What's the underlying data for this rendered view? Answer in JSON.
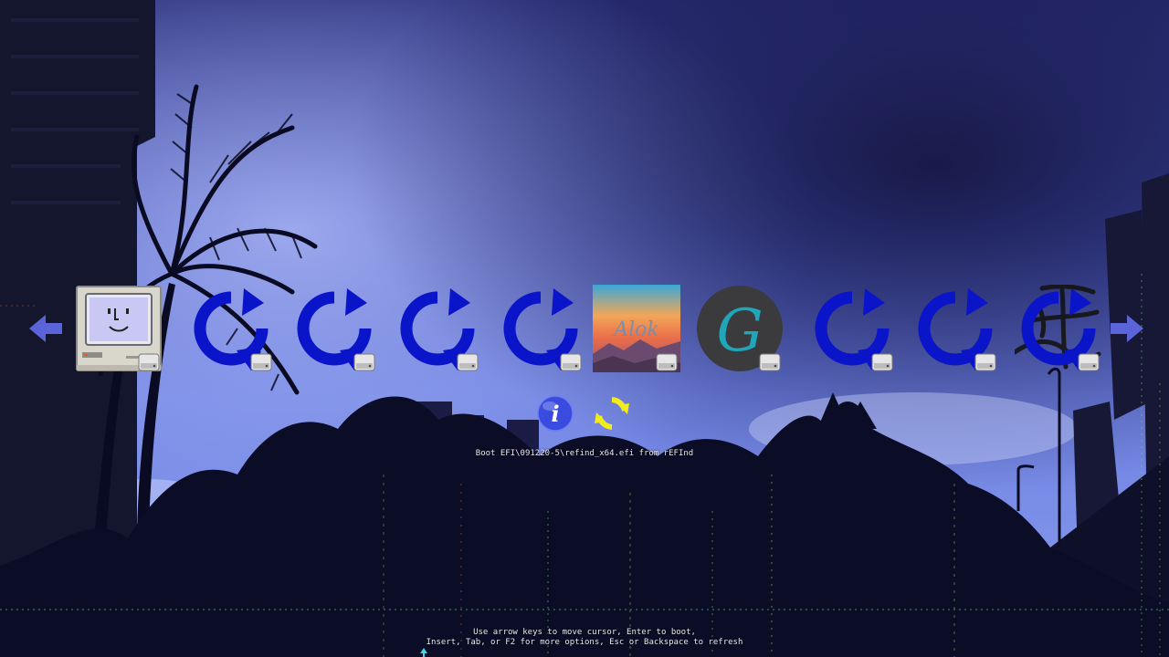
{
  "boot_menu": {
    "selected_label": "Boot EFI\\091220-5\\refind_x64.efi from rEFInd",
    "help_line_1": "Use arrow keys to move cursor, Enter to boot,",
    "help_line_2": "Insert, Tab, or F2 for more options, Esc or Backspace to refresh",
    "entries": [
      {
        "icon": "mac-os-classic-icon"
      },
      {
        "icon": "refind-loader-icon"
      },
      {
        "icon": "refind-loader-icon"
      },
      {
        "icon": "refind-loader-icon"
      },
      {
        "icon": "refind-loader-icon"
      },
      {
        "icon": "alok-wallpaper-icon",
        "text": "Alok"
      },
      {
        "icon": "g-letter-icon",
        "text": "G"
      },
      {
        "icon": "refind-loader-icon"
      },
      {
        "icon": "refind-loader-icon"
      },
      {
        "icon": "refind-loader-with-calligraphy-icon"
      }
    ],
    "tools": [
      {
        "icon": "info-icon",
        "glyph": "i"
      },
      {
        "icon": "refresh-icon"
      }
    ]
  },
  "colors": {
    "refind_blue": "#0a14c8",
    "arrow_blue": "#5a63d8",
    "info_blue": "#3a4be0",
    "refresh_yellow": "#f2ec1a",
    "g_teal": "#1fa6b8"
  }
}
